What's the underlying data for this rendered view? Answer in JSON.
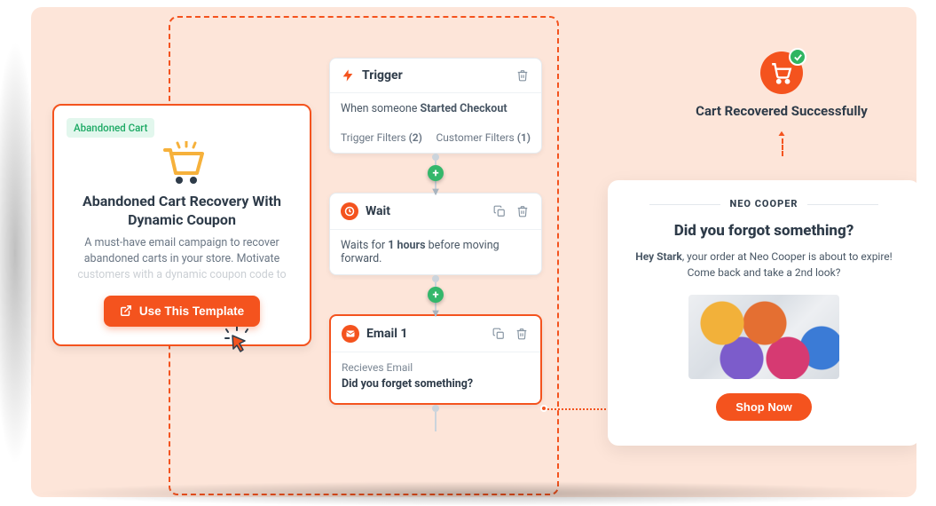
{
  "template": {
    "tag": "Abandoned Cart",
    "title": "Abandoned Cart Recovery With Dynamic Coupon",
    "description": "A must-have email campaign to recover abandoned carts in your store. Motivate",
    "description_faded": "customers with a dynamic coupon code to",
    "cta": "Use This Template"
  },
  "flow": {
    "trigger": {
      "label": "Trigger",
      "body_prefix": "When someone ",
      "body_bold": "Started Checkout",
      "trigger_filters_label": "Trigger Filters ",
      "trigger_filters_count": "(2)",
      "customer_filters_label": "Customer Filters ",
      "customer_filters_count": "(1)"
    },
    "wait": {
      "label": "Wait",
      "body_prefix": "Waits for ",
      "body_bold": "1 hours",
      "body_suffix": " before moving forward."
    },
    "email": {
      "label": "Email 1",
      "body_label": "Recieves Email",
      "subject": "Did you forget something?"
    }
  },
  "success": {
    "title": "Cart Recovered Successfully"
  },
  "email_preview": {
    "brand": "NEO COOPER",
    "headline": "Did you forgot something?",
    "greeting_bold": "Hey Stark",
    "body_rest": ", your order at Neo Cooper is about to expire! Come back and take a 2nd look?",
    "cta": "Shop Now"
  }
}
